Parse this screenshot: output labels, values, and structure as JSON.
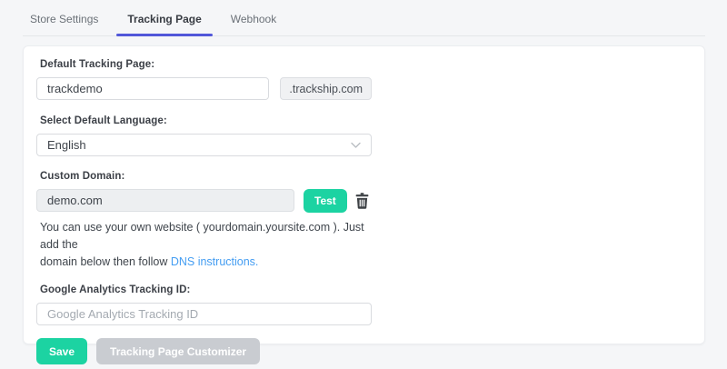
{
  "tabs": [
    {
      "label": "Store Settings",
      "active": false
    },
    {
      "label": "Tracking Page",
      "active": true
    },
    {
      "label": "Webhook",
      "active": false
    }
  ],
  "form": {
    "tracking_page": {
      "label": "Default Tracking Page:",
      "value": "trackdemo",
      "suffix": ".trackship.com"
    },
    "language": {
      "label": "Select Default Language:",
      "selected": "English"
    },
    "custom_domain": {
      "label": "Custom Domain:",
      "value": "demo.com",
      "test_button": "Test",
      "help_line1": "You can use your own website ( yourdomain.yoursite.com ). Just add the",
      "help_line2_prefix": "domain below then follow ",
      "help_link": "DNS instructions."
    },
    "google_analytics": {
      "label": "Google Analytics Tracking ID:",
      "placeholder": "Google Analytics Tracking ID",
      "value": ""
    },
    "buttons": {
      "save": "Save",
      "customizer": "Tracking Page Customizer"
    }
  },
  "colors": {
    "accent_green": "#1cd3a2",
    "active_tab_underline": "#5157d9",
    "link_blue": "#449df2",
    "page_background": "#f5f6f8",
    "disabled_button": "#c9ccd1"
  }
}
